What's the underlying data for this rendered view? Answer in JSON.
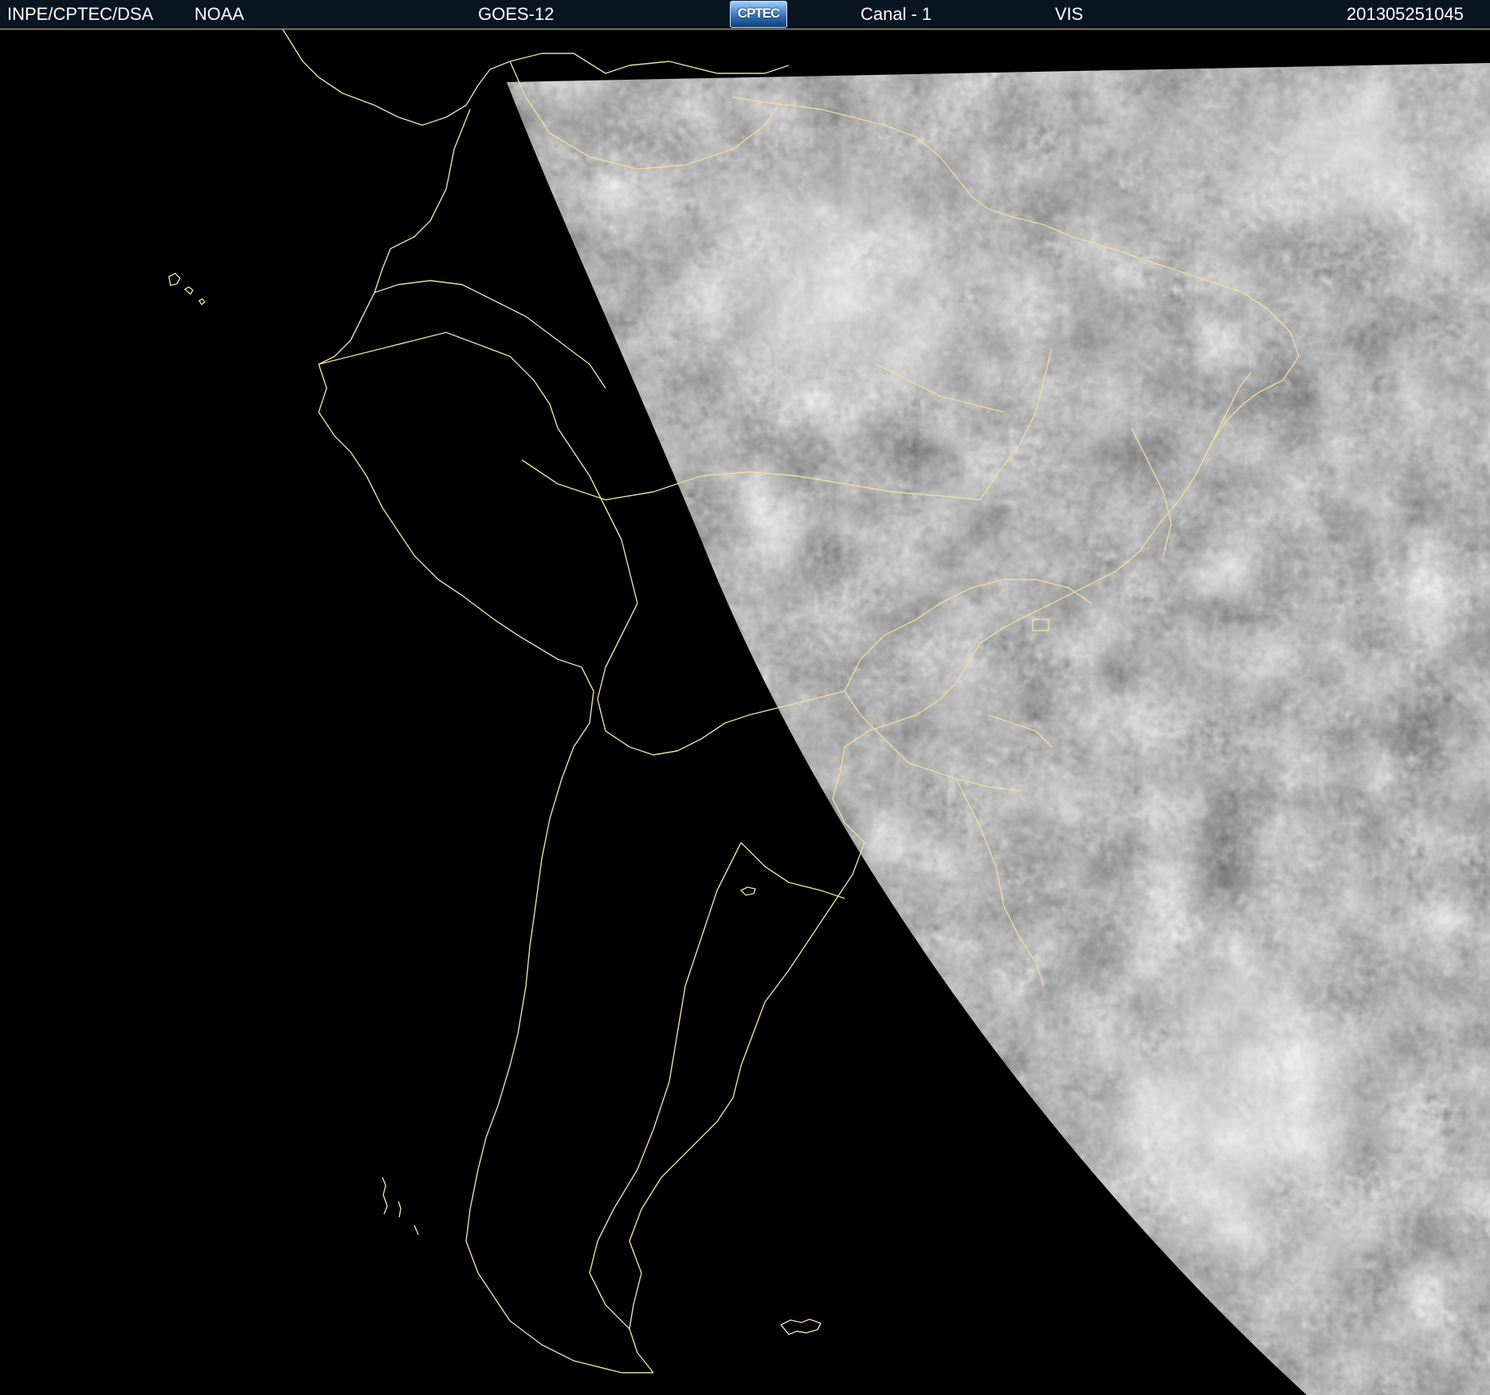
{
  "header": {
    "agency": "INPE/CPTEC/DSA",
    "provider": "NOAA",
    "satellite": "GOES-12",
    "logo_text": "CPTEC",
    "channel": "Canal - 1",
    "band": "VIS",
    "timestamp": "201305251045"
  },
  "colors": {
    "background": "#000000",
    "header_bg": "#0a1522",
    "header_text": "#ffffff",
    "border_lines": "#e8e0a0",
    "cloud_gray": "#5a5a5a"
  },
  "map": {
    "region": "South America",
    "imagery": "visible satellite imagery",
    "icon": "satellite-map"
  }
}
